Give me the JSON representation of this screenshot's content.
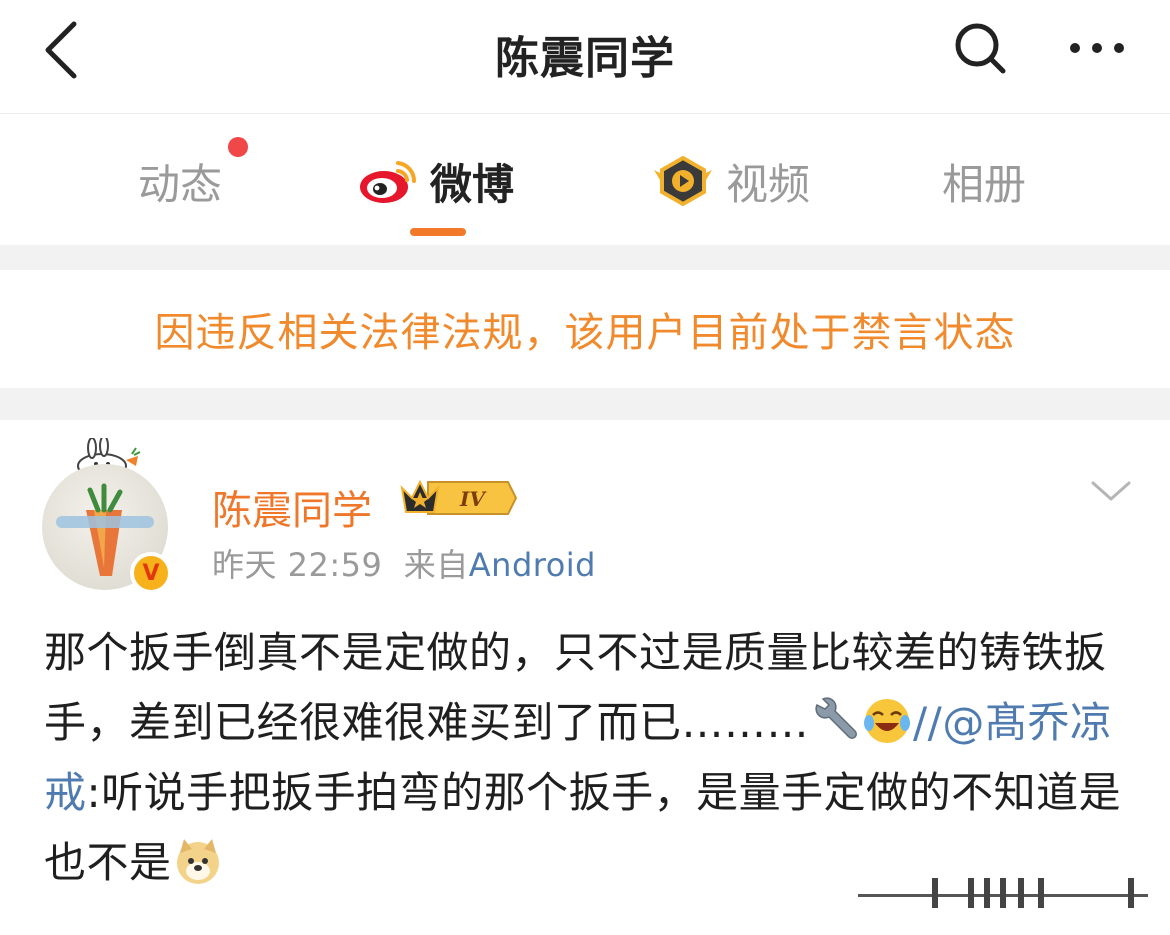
{
  "header": {
    "title": "陈震同学",
    "back_icon": "chevron-left-icon",
    "search_icon": "search-icon",
    "more_icon": "more-dots-icon"
  },
  "tabs": [
    {
      "label": "动态",
      "active": false,
      "has_dot": true
    },
    {
      "label": "微博",
      "active": true,
      "icon": "weibo-logo-icon"
    },
    {
      "label": "视频",
      "active": false,
      "icon": "video-play-icon"
    },
    {
      "label": "相册",
      "active": false
    }
  ],
  "notice": {
    "text": "因违反相关法律法规，该用户目前处于禁言状态"
  },
  "post": {
    "username": "陈震同学",
    "vip_level": "IV",
    "verified_mark": "V",
    "time": "昨天 22:59",
    "source_prefix": "来自",
    "source": "Android",
    "content": {
      "part1": "那个扳手倒真不是定做的，只不过是质量比较差的铸铁扳手，差到已经很难很难买到了而已………",
      "repost_prefix": "//",
      "mention": "@髙乔凉戒",
      "part2": ":听说手把扳手拍弯的那个扳手，是量手定做的不知道是也不是"
    }
  },
  "colors": {
    "accent_orange": "#f2782a",
    "notice_orange": "#f08a2c",
    "link_blue": "#4f7bb0",
    "red_dot": "#f04848"
  }
}
